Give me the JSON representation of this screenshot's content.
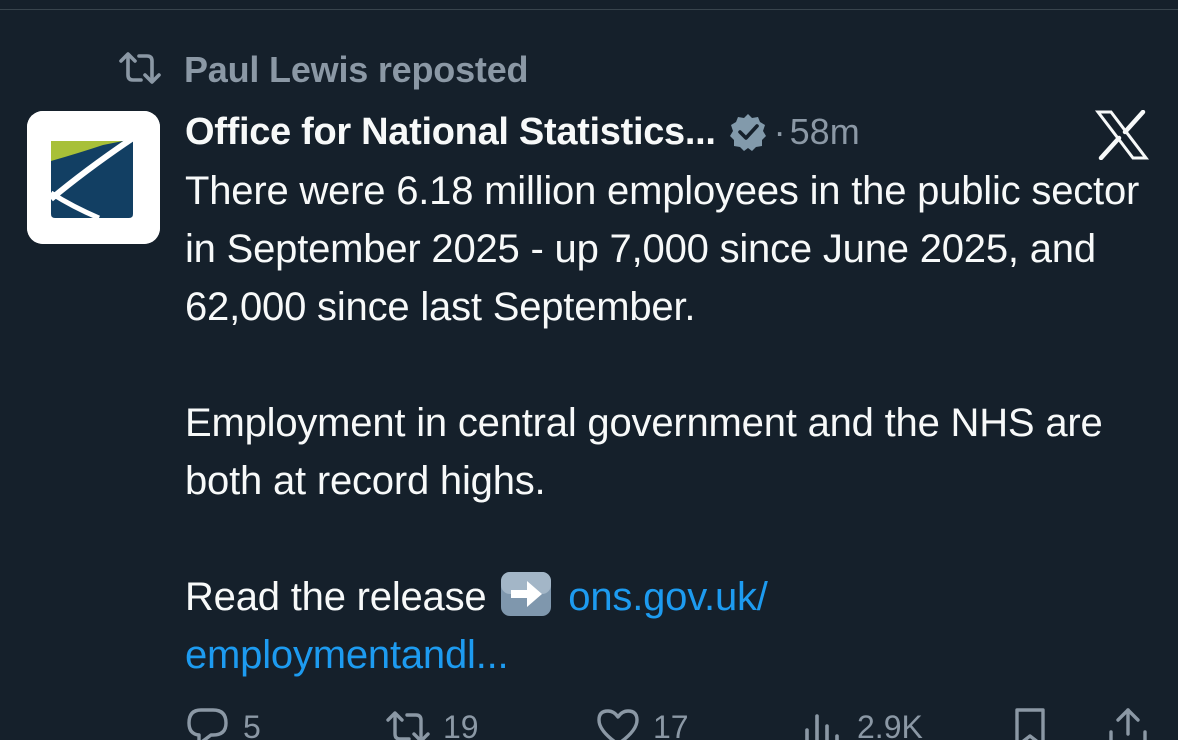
{
  "repost": {
    "text": "Paul Lewis reposted",
    "icon": "repost-icon"
  },
  "author": {
    "display_name": "Office for National Statistics...",
    "verified_icon": "verified-badge-icon",
    "separator": "·",
    "time": "58m",
    "avatar_icon": "ons-logo"
  },
  "brand_icon": "x-logo-icon",
  "tweet": {
    "paragraph1": "There were 6.18 million employees in the public sector in September 2025 - up 7,000 since June 2025, and 62,000 since last September.",
    "paragraph2": "Employment in central government and the NHS are both at record highs.",
    "paragraph3_text": "Read the release",
    "arrow_icon": "right-arrow-emoji-icon",
    "link_part1": "ons.gov.uk/",
    "link_part2": "employmentandl..."
  },
  "actions": {
    "replies": "5",
    "reposts": "19",
    "likes": "17",
    "views": "2.9K"
  },
  "colors": {
    "background": "#15202b",
    "text": "#f7f9f9",
    "muted": "#8b98a5",
    "link": "#1d9bf0"
  }
}
